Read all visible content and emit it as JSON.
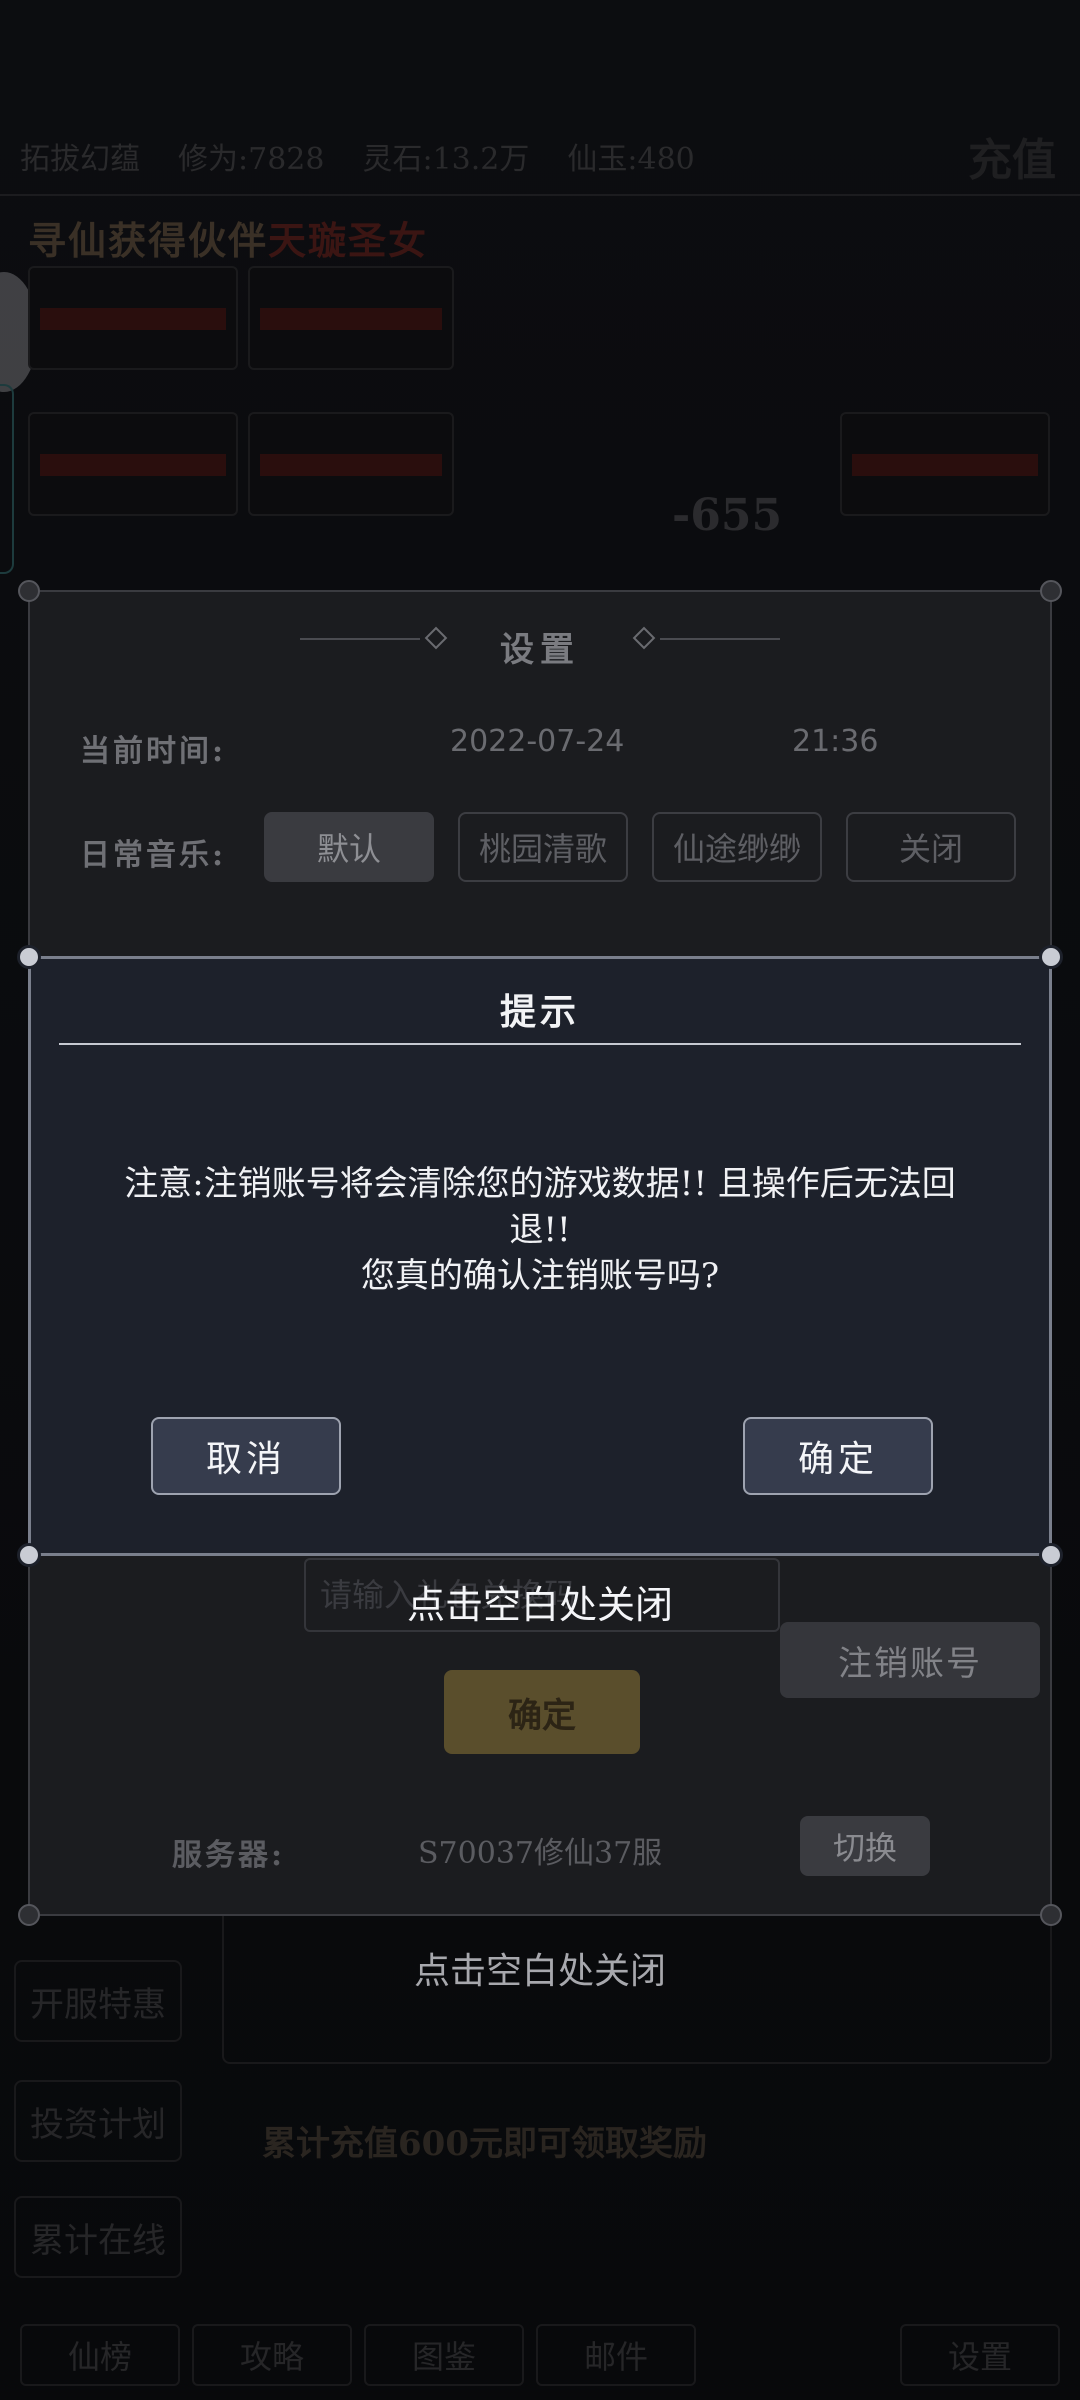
{
  "background": {
    "topbar": {
      "player": "拓拔幻蕴",
      "cultivation": "修为:7828",
      "spirit_stones": "灵石:13.2万",
      "jade": "仙玉:480",
      "logo": "充值"
    },
    "banner": {
      "prefix": "寻仙获得伙伴",
      "highlight": "天璇圣女"
    },
    "damage": "-655",
    "left_menu": [
      "开服特惠",
      "投资计划",
      "累计在线"
    ],
    "reward_text": "累计充值600元即可领取奖励",
    "bottom_nav": [
      "仙榜",
      "攻略",
      "图鉴",
      "邮件",
      "设置"
    ]
  },
  "settings": {
    "title": "设置",
    "time_label": "当前时间:",
    "date": "2022-07-24",
    "time": "21:36",
    "music_label": "日常音乐:",
    "music_options": [
      "默认",
      "桃园清歌",
      "仙途缈缈",
      "关闭"
    ],
    "selected_music": "默认",
    "code_placeholder": "请输入礼包兑换码",
    "logout_label": "注销账号",
    "confirm_label": "确定",
    "server_label": "服务器:",
    "server_value": "S70037修仙37服",
    "switch_label": "切换",
    "close_hint": "点击空白处关闭"
  },
  "dialog": {
    "title": "提示",
    "message_line1": "注意:注销账号将会清除您的游戏数据!! 且操作后无法回",
    "message_line2": "退!!",
    "message_line3": "您真的确认注销账号吗?",
    "cancel_label": "取消",
    "ok_label": "确定",
    "close_hint": "点击空白处关闭"
  }
}
